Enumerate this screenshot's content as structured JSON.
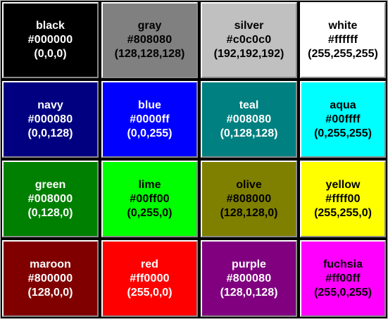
{
  "swatches": [
    {
      "name": "black",
      "hex": "#000000",
      "rgb": "(0,0,0)",
      "fill": "#000000",
      "text_color": "#ffffff"
    },
    {
      "name": "gray",
      "hex": "#808080",
      "rgb": "(128,128,128)",
      "fill": "#808080",
      "text_color": "#000000"
    },
    {
      "name": "silver",
      "hex": "#c0c0c0",
      "rgb": "(192,192,192)",
      "fill": "#c0c0c0",
      "text_color": "#000000"
    },
    {
      "name": "white",
      "hex": "#ffffff",
      "rgb": "(255,255,255)",
      "fill": "#ffffff",
      "text_color": "#000000"
    },
    {
      "name": "navy",
      "hex": "#000080",
      "rgb": "(0,0,128)",
      "fill": "#000080",
      "text_color": "#ffffff"
    },
    {
      "name": "blue",
      "hex": "#0000ff",
      "rgb": "(0,0,255)",
      "fill": "#0000ff",
      "text_color": "#ffffff"
    },
    {
      "name": "teal",
      "hex": "#008080",
      "rgb": "(0,128,128)",
      "fill": "#008080",
      "text_color": "#ffffff"
    },
    {
      "name": "aqua",
      "hex": "#00ffff",
      "rgb": "(0,255,255)",
      "fill": "#00ffff",
      "text_color": "#000000"
    },
    {
      "name": "green",
      "hex": "#008000",
      "rgb": "(0,128,0)",
      "fill": "#008000",
      "text_color": "#ffffff"
    },
    {
      "name": "lime",
      "hex": "#00ff00",
      "rgb": "(0,255,0)",
      "fill": "#00ff00",
      "text_color": "#000000"
    },
    {
      "name": "olive",
      "hex": "#808000",
      "rgb": "(128,128,0)",
      "fill": "#808000",
      "text_color": "#000000"
    },
    {
      "name": "yellow",
      "hex": "#ffff00",
      "rgb": "(255,255,0)",
      "fill": "#ffff00",
      "text_color": "#000000"
    },
    {
      "name": "maroon",
      "hex": "#800000",
      "rgb": "(128,0,0)",
      "fill": "#800000",
      "text_color": "#ffffff"
    },
    {
      "name": "red",
      "hex": "#ff0000",
      "rgb": "(255,0,0)",
      "fill": "#ff0000",
      "text_color": "#ffffff"
    },
    {
      "name": "purple",
      "hex": "#800080",
      "rgb": "(128,0,128)",
      "fill": "#800080",
      "text_color": "#ffffff"
    },
    {
      "name": "fuchsia",
      "hex": "#ff00ff",
      "rgb": "(255,0,255)",
      "fill": "#ff00ff",
      "text_color": "#000000"
    }
  ]
}
